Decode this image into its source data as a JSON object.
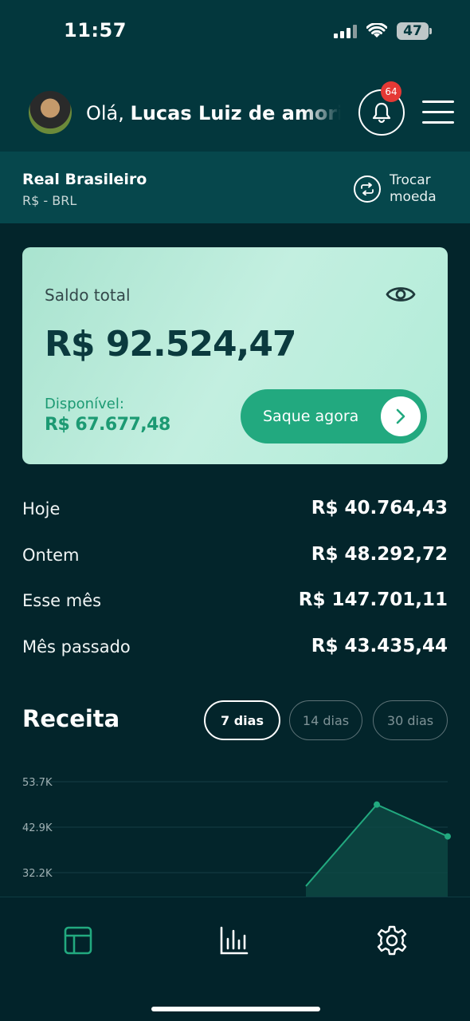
{
  "status_bar": {
    "time": "11:57",
    "battery": "47"
  },
  "header": {
    "greeting_prefix": "Olá, ",
    "user_name": "Lucas Luiz de amorim",
    "notification_count": "64"
  },
  "currency": {
    "name": "Real Brasileiro",
    "code": "R$ - BRL",
    "swap_label": "Trocar moeda"
  },
  "balance": {
    "label": "Saldo total",
    "value": "R$ 92.524,47",
    "available_label": "Disponível:",
    "available_value": "R$ 67.677,48",
    "withdraw_label": "Saque agora"
  },
  "stats": [
    {
      "label": "Hoje",
      "value": "R$ 40.764,43"
    },
    {
      "label": "Ontem",
      "value": "R$ 48.292,72"
    },
    {
      "label": "Esse mês",
      "value": "R$ 147.701,11"
    },
    {
      "label": "Mês passado",
      "value": "R$ 43.435,44"
    }
  ],
  "revenue": {
    "title": "Receita",
    "ranges": [
      "7 dias",
      "14 dias",
      "30 dias"
    ],
    "active_range": "7 dias"
  },
  "chart_data": {
    "type": "area",
    "title": "Receita",
    "y_tick_labels": [
      "53.7K",
      "42.9K",
      "32.2K"
    ],
    "x": [
      5,
      6,
      7
    ],
    "values": [
      29000,
      48292.72,
      40764.43
    ],
    "ylim": [
      21500,
      58000
    ],
    "xlim": [
      1,
      7
    ],
    "colors": {
      "line": "#22a97f",
      "fill": "#0e4a45"
    }
  },
  "colors": {
    "background": "#03252b",
    "header": "#03373d",
    "currency_bar": "#06474c",
    "accent": "#22a97f",
    "badge": "#e53935"
  }
}
